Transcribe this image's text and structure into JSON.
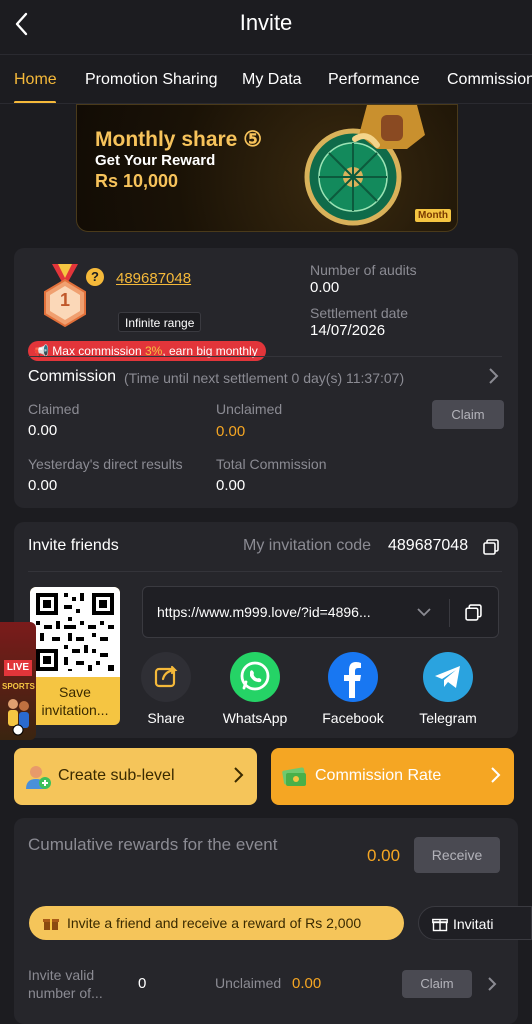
{
  "header": {
    "title": "Invite",
    "back_icon": "chevron-left-icon"
  },
  "tabs": [
    {
      "label": "Home",
      "active": true
    },
    {
      "label": "Promotion Sharing",
      "active": false
    },
    {
      "label": "My Data",
      "active": false
    },
    {
      "label": "Performance",
      "active": false
    },
    {
      "label": "Commission",
      "active": false
    }
  ],
  "banner": {
    "line1": "Monthly share ⑤",
    "line2": "Get Your Reward",
    "line3": "Rs 10,000",
    "tag": "Month"
  },
  "account": {
    "level": "1",
    "help_icon": "?",
    "uid": "489687048",
    "range_badge": "Infinite range",
    "audits_label": "Number of audits",
    "audits_value": "0.00",
    "settlement_label": "Settlement date",
    "settlement_value": "14/07/2026",
    "promo_prefix": "Max commission ",
    "promo_highlight": "3%",
    "promo_suffix": ", earn big monthly"
  },
  "commission": {
    "title": "Commission",
    "subtitle": "(Time until next settlement  0 day(s) 11:37:07)",
    "claimed_label": "Claimed",
    "claimed_value": "0.00",
    "unclaimed_label": "Unclaimed",
    "unclaimed_value": "0.00",
    "claim_button": "Claim",
    "yesterday_label": "Yesterday's direct results",
    "yesterday_value": "0.00",
    "total_label": "Total Commission",
    "total_value": "0.00"
  },
  "invite": {
    "title": "Invite friends",
    "code_label": "My invitation code",
    "code_value": "489687048",
    "qr_label": "Save invitation...",
    "url": "https://www.m999.love/?id=4896...",
    "share": [
      {
        "label": "Share",
        "icon": "share-icon",
        "color": "#2f2f35"
      },
      {
        "label": "WhatsApp",
        "icon": "whatsapp-icon",
        "color": "#25d366"
      },
      {
        "label": "Facebook",
        "icon": "facebook-icon",
        "color": "#1877f2"
      },
      {
        "label": "Telegram",
        "icon": "telegram-icon",
        "color": "#2aa3df"
      }
    ]
  },
  "side_ad": {
    "live": "LIVE",
    "sports": "SPORTS"
  },
  "actions": {
    "create_label": "Create sub-level",
    "rate_label": "Commission Rate"
  },
  "rewards": {
    "title": "Cumulative rewards for the event",
    "value": "0.00",
    "receive_button": "Receive",
    "invite_pill": "Invite a friend and receive a reward of Rs 2,000",
    "invitation_pill": "Invitati",
    "valid_label": "Invite valid number of...",
    "valid_value": "0",
    "unclaimed_label": "Unclaimed",
    "unclaimed_value": "0.00",
    "claim_button": "Claim"
  },
  "colors": {
    "accent": "#f5b93a",
    "orange": "#f5a623",
    "background": "#1c1c20",
    "card": "#26262b"
  }
}
